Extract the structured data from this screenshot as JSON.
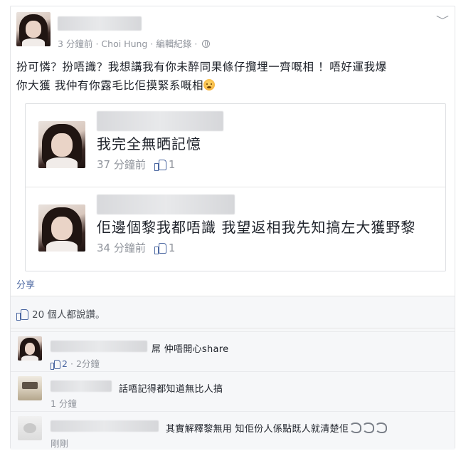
{
  "post": {
    "time": "3 分鐘前",
    "author": "Choi Hung",
    "edit_history": "編輯紀錄",
    "separator": "·",
    "text_line1": "扮可憐？扮唔識？我想講我有你未醉同果條仔攬埋一齊嘅相 ！唔好運我爆",
    "text_line2": "你大獲 我仲有你露毛比佢摸緊系嘅相",
    "shared_comments": [
      {
        "text": "我完全無晒記憶",
        "time": "37 分鐘前",
        "likes": "1"
      },
      {
        "text": "佢邊個黎我都唔識 我望返相我先知搞左大獲野黎",
        "time": "34 分鐘前",
        "likes": "1"
      }
    ],
    "share_label": "分享",
    "likes_summary": "20 個人都說讚。"
  },
  "comments": [
    {
      "text": "屌 仲唔開心share",
      "likes": "2",
      "time": "2分鐘",
      "separator": "·"
    },
    {
      "text": "話唔記得都知道無比人搞",
      "time": "1 分鐘"
    },
    {
      "text": "其實解釋黎無用 知佢份人係點既人就清楚佢",
      "time": "剛剛"
    }
  ],
  "icons": {
    "like": "thumbs-up-icon",
    "audience": "globe-icon",
    "menu": "chevron-down-icon",
    "emoji": "smiley-emoji-icon",
    "swirl": "swirl-emoji-icon"
  },
  "colors": {
    "link": "#4b67a1",
    "meta": "#90949c",
    "text": "#1d2129",
    "bg_comments": "#f6f7f9"
  }
}
